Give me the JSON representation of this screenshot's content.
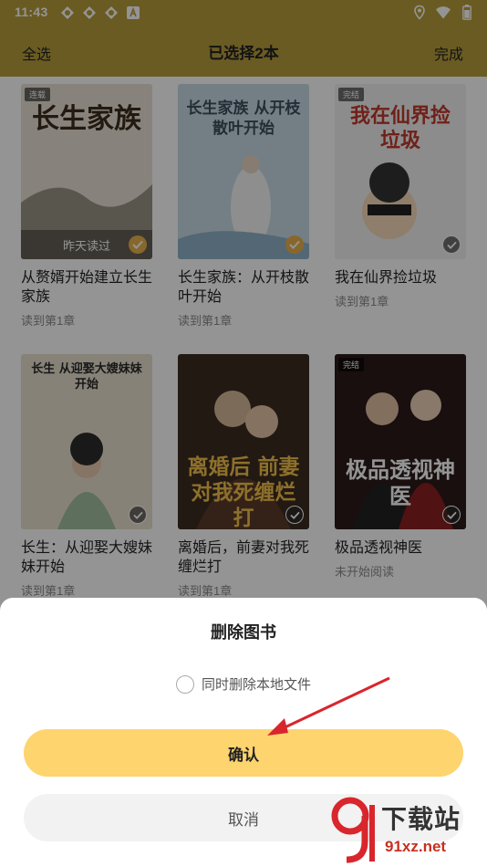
{
  "status_bar": {
    "time": "11:43",
    "icons": [
      "sync-icon",
      "sync-icon",
      "sync-icon",
      "text-a-icon",
      "location-icon",
      "wifi-icon",
      "battery-icon"
    ]
  },
  "nav": {
    "select_all": "全选",
    "title": "已选择2本",
    "done": "完成"
  },
  "books": [
    {
      "title": "从赘婿开始建立长生家族",
      "progress": "读到第1章",
      "selected": true,
      "tag": "连载",
      "cover_text": "长生家族",
      "cover_read": "昨天读过"
    },
    {
      "title": "长生家族：从开枝散叶开始",
      "progress": "读到第1章",
      "selected": true,
      "tag": "",
      "cover_text": "长生家族 从开枝散叶开始",
      "cover_read": ""
    },
    {
      "title": "我在仙界捡垃圾",
      "progress": "读到第1章",
      "selected": false,
      "tag": "完结",
      "cover_text": "我在仙界捡垃圾",
      "cover_read": ""
    },
    {
      "title": "长生：从迎娶大嫂妹妹开始",
      "progress": "读到第1章",
      "selected": false,
      "tag": "",
      "cover_text": "长生 从迎娶大嫂妹妹开始",
      "cover_read": ""
    },
    {
      "title": "离婚后，前妻对我死缠烂打",
      "progress": "读到第1章",
      "selected": false,
      "tag": "",
      "cover_text": "离婚后 前妻对我死缠烂打",
      "cover_read": ""
    },
    {
      "title": "极品透视神医",
      "progress": "未开始阅读",
      "selected": false,
      "tag": "完结",
      "cover_text": "极品透视神医",
      "cover_read": ""
    }
  ],
  "sheet": {
    "title": "删除图书",
    "option_label": "同时删除本地文件",
    "option_checked": false,
    "confirm": "确认",
    "cancel": "取消"
  },
  "watermark": {
    "logo_text": "下载站",
    "url": "91xz.net"
  },
  "colors": {
    "header": "#b79e3d",
    "confirm": "#fed46e",
    "cancel": "#f2f2f2",
    "check": "#e9b24c",
    "arrow": "#d8262c"
  }
}
